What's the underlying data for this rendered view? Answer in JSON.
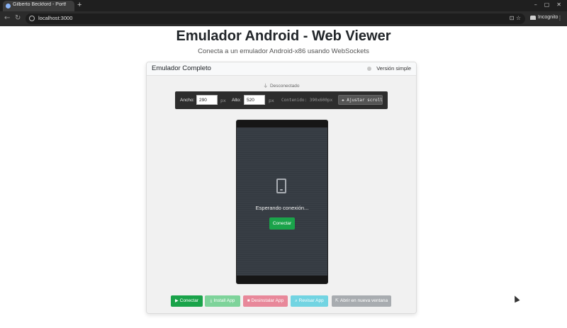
{
  "browser": {
    "tab_title": "Gilberto Beckford - Portf",
    "new_tab": "+",
    "url": "localhost:3000",
    "incognito_label": "Incognito",
    "window_controls": [
      "–",
      "▢",
      "✕"
    ]
  },
  "page": {
    "title": "Emulador Android - Web Viewer",
    "subtitle": "Conecta a un emulador Android-x86 usando WebSockets"
  },
  "card": {
    "title": "Emulador Completo",
    "version_label": "Versión simple",
    "status_dot_color": "#c8c8c8"
  },
  "status": {
    "label": "Desconectado"
  },
  "dimensions": {
    "width_label": "Ancho:",
    "width_value": "290",
    "height_label": "Alto:",
    "height_value": "520",
    "unit": "px",
    "content_text": "Contenido: 390x600px",
    "adjust_button": "Ajustar scroll"
  },
  "phone": {
    "waiting_text": "Esperando conexión...",
    "connect_button": "Conectar"
  },
  "actions": {
    "connect": {
      "label": "Conectar",
      "color": "#1aa34a"
    },
    "install": {
      "label": "Install App",
      "color": "#7ed39a"
    },
    "uninstall": {
      "label": "Desinstalar App",
      "color": "#e8889a"
    },
    "review": {
      "label": "Revisar App",
      "color": "#72d4e2"
    },
    "open_new": {
      "label": "Abrir en nueva ventana",
      "color": "#a8acb0"
    }
  }
}
